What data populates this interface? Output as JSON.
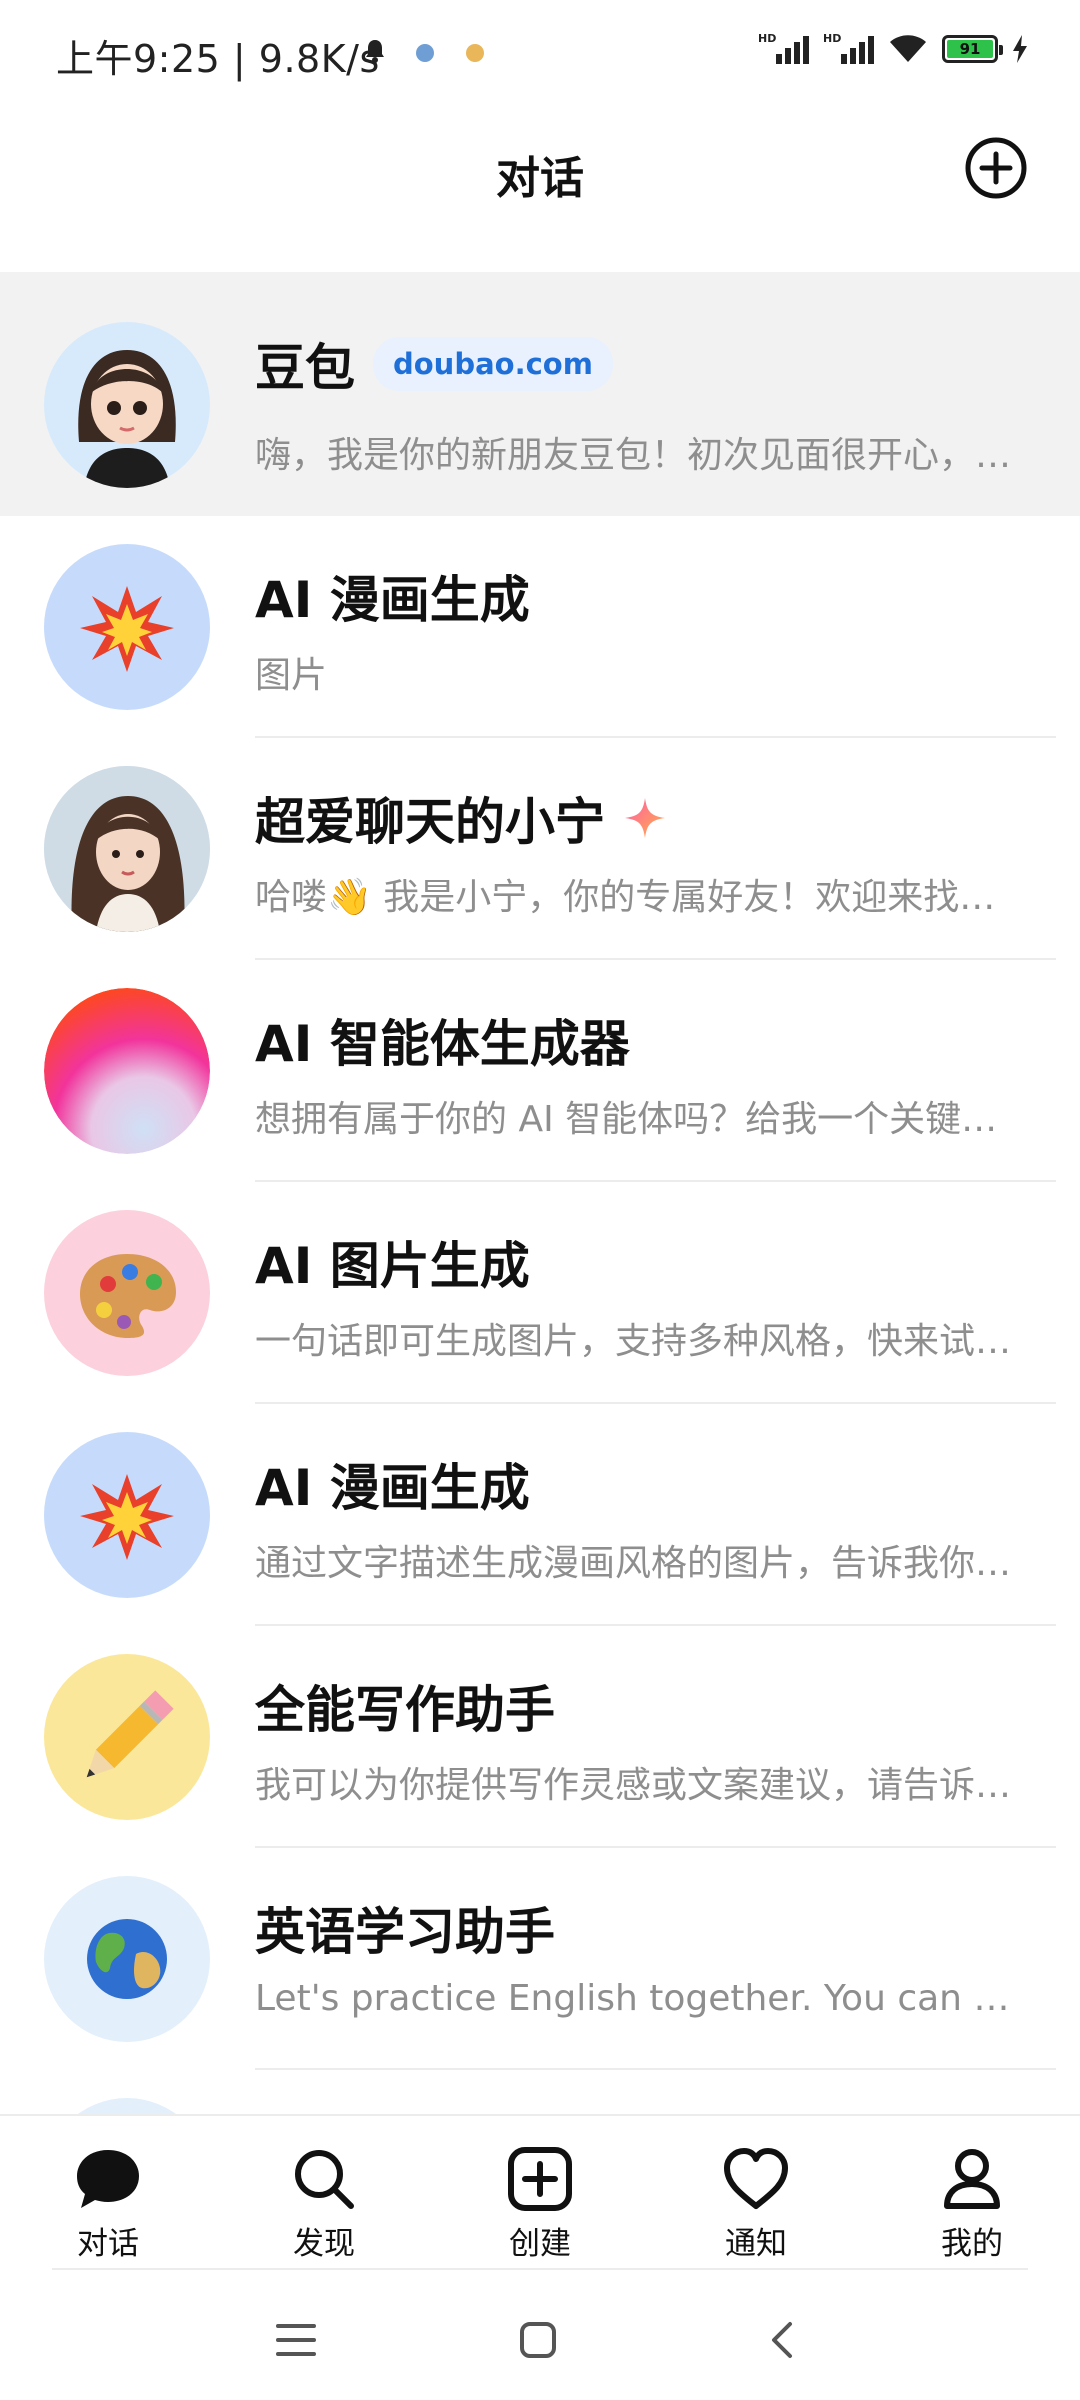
{
  "status_bar": {
    "time": "上午9:25 | 9.8K/s",
    "battery": "91"
  },
  "header": {
    "title": "对话"
  },
  "conversations": [
    {
      "title": "豆包",
      "badge": "doubao.com",
      "preview": "嗨，我是你的新朋友豆包！初次见面很开心，有什么我可以帮你的吗"
    },
    {
      "title": "AI 漫画生成",
      "preview": "图片"
    },
    {
      "title": "超爱聊天的小宁",
      "preview": "哈喽👋 我是小宁，你的专属好友！欢迎来找我聊天"
    },
    {
      "title": "AI 智能体生成器",
      "preview": "想拥有属于你的 AI 智能体吗？给我一个关键词试试"
    },
    {
      "title": "AI 图片生成",
      "preview": "一句话即可生成图片，支持多种风格，快来试试吧"
    },
    {
      "title": "AI 漫画生成",
      "preview": "通过文字描述生成漫画风格的图片，告诉我你的想法"
    },
    {
      "title": "全能写作助手",
      "preview": "我可以为你提供写作灵感或文案建议，请告诉我需求"
    },
    {
      "title": "英语学习助手",
      "preview": "Let's practice English together. You can ask me anything"
    }
  ],
  "bottom_nav": [
    {
      "label": "对话",
      "icon": "chat-bubble-icon"
    },
    {
      "label": "发现",
      "icon": "search-icon"
    },
    {
      "label": "创建",
      "icon": "create-plus-icon"
    },
    {
      "label": "通知",
      "icon": "heart-icon"
    },
    {
      "label": "我的",
      "icon": "profile-icon"
    }
  ],
  "colors": {
    "accent_blue": "#1f6fd9",
    "badge_bg": "#e8f1fd",
    "selected_row_bg": "#f2f2f2",
    "battery_green": "#2ec24a"
  }
}
